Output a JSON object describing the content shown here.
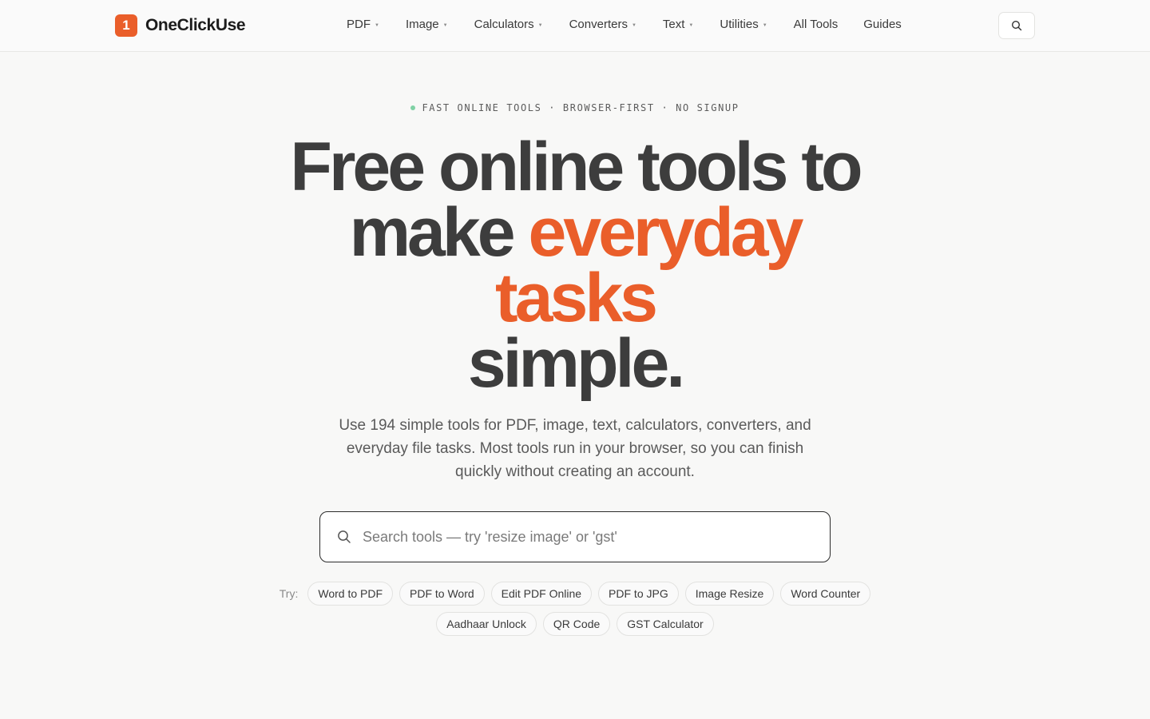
{
  "header": {
    "logo_mark": "1",
    "brand": "OneClickUse",
    "nav": [
      {
        "label": "PDF",
        "has_dropdown": true
      },
      {
        "label": "Image",
        "has_dropdown": true
      },
      {
        "label": "Calculators",
        "has_dropdown": true
      },
      {
        "label": "Converters",
        "has_dropdown": true
      },
      {
        "label": "Text",
        "has_dropdown": true
      },
      {
        "label": "Utilities",
        "has_dropdown": true
      },
      {
        "label": "All Tools",
        "has_dropdown": false
      },
      {
        "label": "Guides",
        "has_dropdown": false
      }
    ],
    "search_icon": "search-icon"
  },
  "hero": {
    "eyebrow": "FAST ONLINE TOOLS · BROWSER-FIRST · NO SIGNUP",
    "headline": {
      "line1": "Free online tools to",
      "line2_plain": "make ",
      "line2_accent": "everyday",
      "line3_accent": "tasks",
      "line4": "simple."
    },
    "subtitle": "Use 194 simple tools for PDF, image, text, calculators, converters, and everyday file tasks. Most tools run in your browser, so you can finish quickly without creating an account.",
    "search": {
      "placeholder": "Search tools — try 'resize image' or 'gst'",
      "value": ""
    },
    "try_label": "Try:",
    "chips_row1": [
      "Word to PDF",
      "PDF to Word",
      "Edit PDF Online",
      "PDF to JPG",
      "Image Resize",
      "Word Counter"
    ],
    "chips_row2": [
      "Aadhaar Unlock",
      "QR Code",
      "GST Calculator"
    ]
  },
  "colors": {
    "accent": "#ea5e2a",
    "text_dark": "#3d3d3d",
    "background": "#f8f8f7",
    "status_dot": "#7fd1a4"
  }
}
